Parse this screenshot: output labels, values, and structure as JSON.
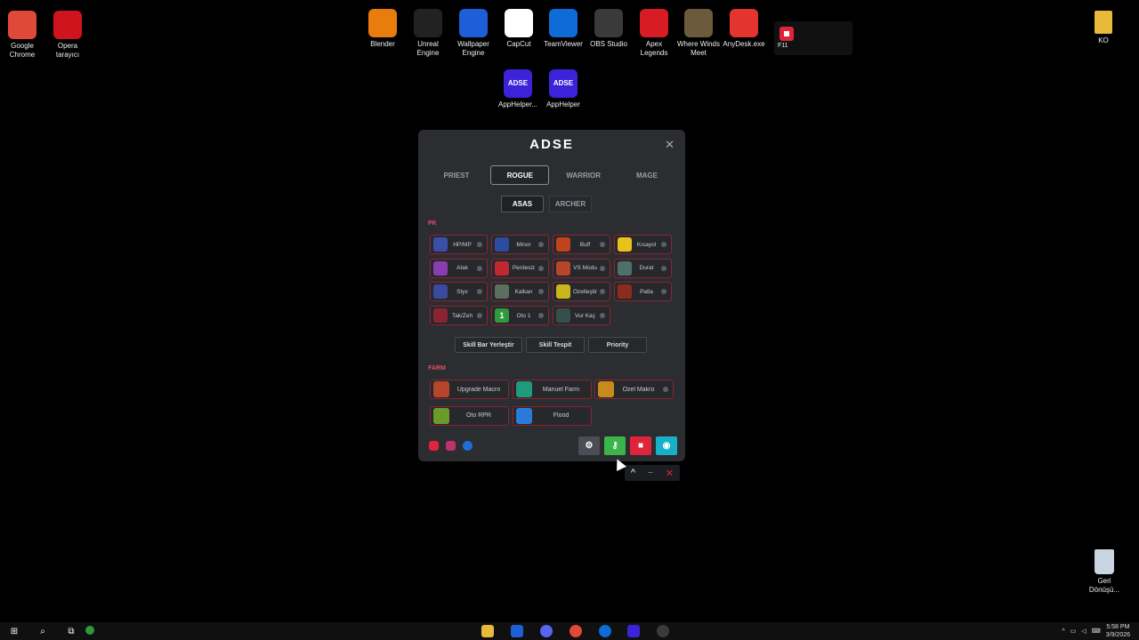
{
  "desktop": {
    "left_icons": [
      {
        "label": "Google\nChrome",
        "icon": "chrome-icon",
        "color": "#e04838"
      },
      {
        "label": "Opera\ntarayıcı",
        "icon": "opera-icon",
        "color": "#d0141e"
      }
    ],
    "top_icons": [
      {
        "label": "Blender",
        "icon": "blender-icon",
        "color": "#e87d0d"
      },
      {
        "label": "Unreal\nEngine",
        "icon": "unreal-icon",
        "color": "#222222"
      },
      {
        "label": "Wallpaper\nEngine",
        "icon": "wallpaper-engine-icon",
        "color": "#1e5fd8"
      },
      {
        "label": "CapCut",
        "icon": "capcut-icon",
        "color": "#ffffff"
      },
      {
        "label": "TeamViewer",
        "icon": "teamviewer-icon",
        "color": "#0e6bd8"
      },
      {
        "label": "OBS Studio",
        "icon": "obs-icon",
        "color": "#3a3a3a"
      },
      {
        "label": "Apex\nLegends",
        "icon": "apex-icon",
        "color": "#d81c24"
      },
      {
        "label": "Where Winds\nMeet",
        "icon": "where-winds-meet-icon",
        "color": "#6b5a3c"
      },
      {
        "label": "AnyDesk.exe",
        "icon": "anydesk-icon",
        "color": "#e3342f"
      }
    ],
    "second_row_icons": [
      {
        "label": "AppHelper...",
        "icon": "apphelper-icon",
        "text": "ADSE",
        "color": "#3c22d8"
      },
      {
        "label": "AppHelper",
        "icon": "apphelper-icon",
        "text": "ADSE",
        "color": "#3c22d8"
      }
    ],
    "f11_label": "F11",
    "folder_label": "KO",
    "recycle_label": "Geri\nDönüşü..."
  },
  "app": {
    "title": "ADSE",
    "class_tabs": [
      "PRIEST",
      "ROGUE",
      "WARRIOR",
      "MAGE"
    ],
    "active_class": "ROGUE",
    "sub_tabs": [
      "ASAS",
      "ARCHER"
    ],
    "active_sub": "ASAS",
    "pk_label": "PK",
    "pk_skills": [
      {
        "name": "HP/MP",
        "icon": "hp-mp-icon",
        "color": "#3a4fa8"
      },
      {
        "name": "Minor",
        "icon": "minor-icon",
        "color": "#2b4ca0"
      },
      {
        "name": "Buff",
        "icon": "buff-icon",
        "color": "#c0431c"
      },
      {
        "name": "Kısayol",
        "icon": "star-icon",
        "color": "#e8c21a"
      },
      {
        "name": "Atak",
        "icon": "atak-icon",
        "color": "#8a3db0"
      },
      {
        "name": "Perdesiz",
        "icon": "perdesiz-icon",
        "color": "#c0282f"
      },
      {
        "name": "VS Modu",
        "icon": "vs-mode-icon",
        "color": "#b5462a"
      },
      {
        "name": "Durat",
        "icon": "durat-icon",
        "color": "#4f6f6a"
      },
      {
        "name": "Styx",
        "icon": "styx-icon",
        "color": "#3a4aa0"
      },
      {
        "name": "Kalkan",
        "icon": "kalkan-icon",
        "color": "#5b6f60"
      },
      {
        "name": "Özelleştir",
        "icon": "keyboard-icon",
        "color": "#c9b51c"
      },
      {
        "name": "Patla",
        "icon": "patla-icon",
        "color": "#8a2d1e"
      },
      {
        "name": "Tak/Zeh",
        "icon": "tak-zeh-icon",
        "color": "#8a2430"
      },
      {
        "name": "Oto 1",
        "icon": "oto-1-icon",
        "text": "1",
        "color": "#2e9a3e"
      },
      {
        "name": "Vur Kaç",
        "icon": "vur-kac-icon",
        "color": "#34504a"
      }
    ],
    "actions": [
      "Skill Bar Yerleştir",
      "Skill Tespit",
      "Priority"
    ],
    "farm_label": "FARM",
    "farm_skills": [
      {
        "name": "Upgrade Macro",
        "icon": "upgrade-macro-icon",
        "color": "#b5462a",
        "dot": false
      },
      {
        "name": "Manuel Farm",
        "icon": "refresh-icon",
        "color": "#1f9a7a",
        "dot": false
      },
      {
        "name": "Özel Makro",
        "icon": "scroll-icon",
        "color": "#c98a1c",
        "dot": true
      },
      {
        "name": "Oto RPR",
        "icon": "oto-rpr-icon",
        "color": "#6a9a2a",
        "dot": false
      },
      {
        "name": "Flood",
        "icon": "chat-icon",
        "color": "#2a7ad8",
        "dot": false
      }
    ],
    "footer_buttons": [
      {
        "icon": "gear-icon",
        "glyph": "⚙",
        "color": "#4a4d53"
      },
      {
        "icon": "key-icon",
        "glyph": "⚷",
        "color": "#3bb44a"
      },
      {
        "icon": "stop-icon",
        "glyph": "■",
        "color": "#e0243b"
      },
      {
        "icon": "eye-icon",
        "glyph": "◉",
        "color": "#18b0c8"
      }
    ]
  },
  "taskbar": {
    "time": "5:58 PM",
    "date": "3/9/2026"
  }
}
